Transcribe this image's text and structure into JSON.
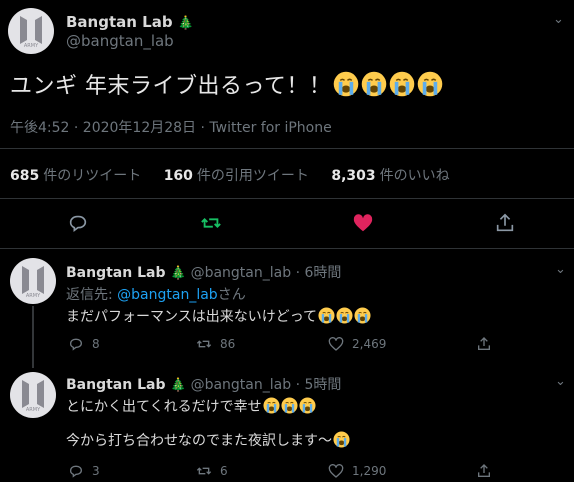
{
  "main": {
    "name": "Bangtan Lab",
    "badge": "🎄",
    "handle": "@bangtan_lab",
    "text": "ユンギ 年末ライブ出るって！！",
    "emoji_count": 4,
    "meta": "午後4:52 · 2020年12月28日 · Twitter for iPhone",
    "stats": {
      "retweets_num": "685",
      "retweets_label": "件のリツイート",
      "quotes_num": "160",
      "quotes_label": "件の引用ツイート",
      "likes_num": "8,303",
      "likes_label": "件のいいね"
    },
    "icons": [
      "reply-icon",
      "retweet-icon",
      "like-icon",
      "share-icon"
    ],
    "colors": {
      "retweet": "#17bf63",
      "like": "#e0245e"
    }
  },
  "replies": [
    {
      "name": "Bangtan Lab",
      "badge": "🎄",
      "handle": "@bangtan_lab",
      "time": "· 6時間",
      "replying_prefix": "返信先: ",
      "replying_handle": "@bangtan_lab",
      "replying_suffix": "さん",
      "text": "まだパフォーマンスは出来ないけどって",
      "reply_count": "8",
      "retweet_count": "86",
      "like_count": "2,469"
    },
    {
      "name": "Bangtan Lab",
      "badge": "🎄",
      "handle": "@bangtan_lab",
      "time": "· 5時間",
      "text": "とにかく出てくれるだけで幸せ",
      "text2": "今から打ち合わせなのでまた夜訳します〜",
      "reply_count": "3",
      "retweet_count": "6",
      "like_count": "1,290"
    }
  ],
  "caret": "⌄",
  "link_color": "#1da1f2"
}
